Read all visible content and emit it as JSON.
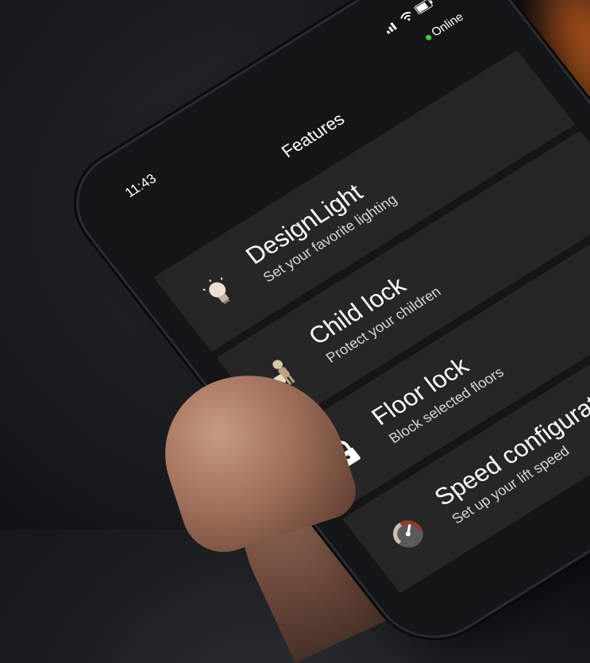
{
  "status": {
    "time": "11:43",
    "online_label": "Online",
    "online_color": "#47c24a"
  },
  "header": {
    "title": "Features"
  },
  "features": [
    {
      "title": "DesignLight",
      "subtitle": "Set your favorite lighting",
      "icon": "lightbulb-icon"
    },
    {
      "title": "Child lock",
      "subtitle": "Protect your children",
      "icon": "child-with-bag-icon"
    },
    {
      "title": "Floor lock",
      "subtitle": "Block selected floors",
      "icon": "padlock-icon"
    },
    {
      "title": "Speed configuration",
      "subtitle": "Set up your lift speed",
      "icon": "speedometer-icon"
    }
  ]
}
